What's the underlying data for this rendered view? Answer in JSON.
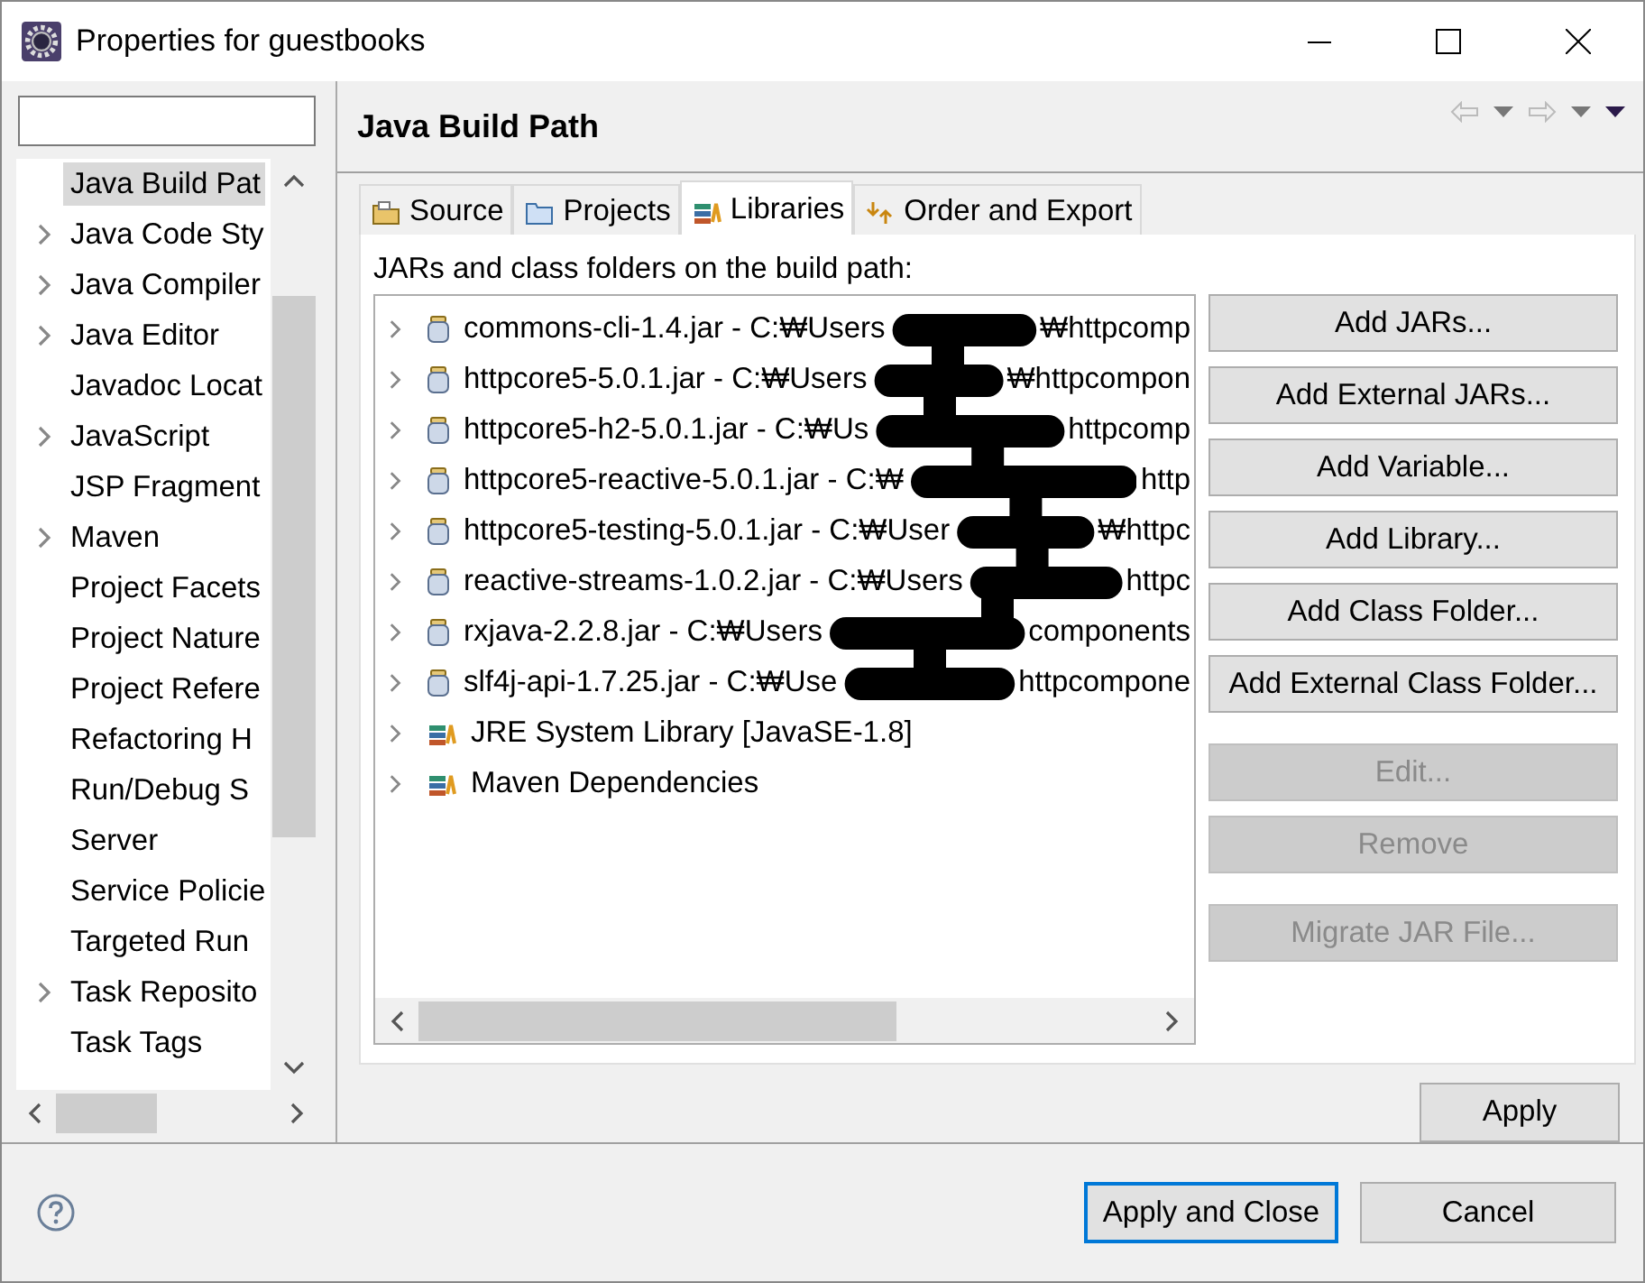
{
  "window": {
    "title": "Properties for guestbooks"
  },
  "sidebar": {
    "items": [
      {
        "label": "Java Build Pat",
        "expandable": false,
        "selected": true
      },
      {
        "label": "Java Code Sty",
        "expandable": true,
        "selected": false
      },
      {
        "label": "Java Compiler",
        "expandable": true,
        "selected": false
      },
      {
        "label": "Java Editor",
        "expandable": true,
        "selected": false
      },
      {
        "label": "Javadoc Locat",
        "expandable": false,
        "selected": false
      },
      {
        "label": "JavaScript",
        "expandable": true,
        "selected": false
      },
      {
        "label": "JSP Fragment",
        "expandable": false,
        "selected": false
      },
      {
        "label": "Maven",
        "expandable": true,
        "selected": false
      },
      {
        "label": "Project Facets",
        "expandable": false,
        "selected": false
      },
      {
        "label": "Project Nature",
        "expandable": false,
        "selected": false
      },
      {
        "label": "Project Refere",
        "expandable": false,
        "selected": false
      },
      {
        "label": "Refactoring H",
        "expandable": false,
        "selected": false
      },
      {
        "label": "Run/Debug S",
        "expandable": false,
        "selected": false
      },
      {
        "label": "Server",
        "expandable": false,
        "selected": false
      },
      {
        "label": "Service Policie",
        "expandable": false,
        "selected": false
      },
      {
        "label": "Targeted Run",
        "expandable": false,
        "selected": false
      },
      {
        "label": "Task Reposito",
        "expandable": true,
        "selected": false
      },
      {
        "label": "Task Tags",
        "expandable": false,
        "selected": false
      }
    ]
  },
  "page": {
    "title": "Java Build Path",
    "tabs": [
      {
        "label": "Source",
        "kind": "source",
        "selected": false
      },
      {
        "label": "Projects",
        "kind": "projects",
        "selected": false
      },
      {
        "label": "Libraries",
        "kind": "libraries",
        "selected": true
      },
      {
        "label": "Order and Export",
        "kind": "order",
        "selected": false
      }
    ],
    "list_label": "JARs and class folders on the build path:",
    "entries": {
      "redacted": true,
      "items": [
        {
          "kind": "jar",
          "text": "commons-cli-1.4.jar - C:₩Users",
          "text_after": "₩httpcomp"
        },
        {
          "kind": "jar",
          "text": "httpcore5-5.0.1.jar - C:₩Users",
          "text_after": "₩httpcompon"
        },
        {
          "kind": "jar",
          "text": "httpcore5-h2-5.0.1.jar - C:₩Us",
          "text_after": "httpcomp"
        },
        {
          "kind": "jar",
          "text": "httpcore5-reactive-5.0.1.jar - C:₩",
          "text_after": "http"
        },
        {
          "kind": "jar",
          "text": "httpcore5-testing-5.0.1.jar - C:₩User",
          "text_after": "₩httpc"
        },
        {
          "kind": "jar",
          "text": "reactive-streams-1.0.2.jar - C:₩Users",
          "text_after": "httpc"
        },
        {
          "kind": "jar",
          "text": "rxjava-2.2.8.jar - C:₩Users",
          "text_after": "components"
        },
        {
          "kind": "jar",
          "text": "slf4j-api-1.7.25.jar - C:₩Use",
          "text_after": "httpcompone"
        },
        {
          "kind": "library",
          "text": "JRE System Library [JavaSE-1.8]"
        },
        {
          "kind": "library",
          "text": "Maven Dependencies"
        }
      ]
    },
    "button_groups": [
      [
        {
          "label": "Add JARs...",
          "disabled": false
        },
        {
          "label": "Add External JARs...",
          "disabled": false
        },
        {
          "label": "Add Variable...",
          "disabled": false
        },
        {
          "label": "Add Library...",
          "disabled": false
        },
        {
          "label": "Add Class Folder...",
          "disabled": false
        },
        {
          "label": "Add External Class Folder...",
          "disabled": false
        }
      ],
      [
        {
          "label": "Edit...",
          "disabled": true
        },
        {
          "label": "Remove",
          "disabled": true
        }
      ],
      [
        {
          "label": "Migrate JAR File...",
          "disabled": true
        }
      ]
    ],
    "apply": "Apply"
  },
  "footer": {
    "buttons": [
      {
        "label": "Apply and Close",
        "default": true
      },
      {
        "label": "Cancel",
        "default": false
      }
    ]
  }
}
